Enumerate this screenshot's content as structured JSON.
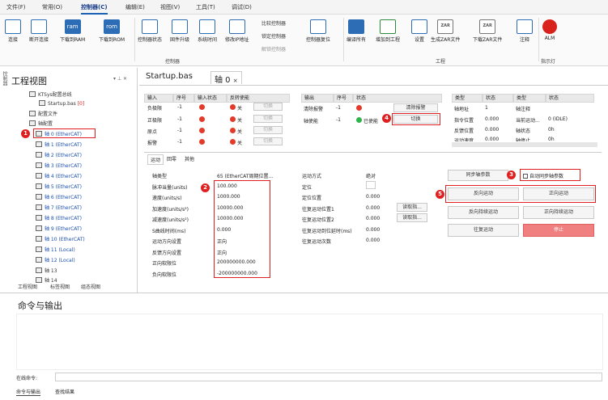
{
  "menu": {
    "items": [
      "文件(F)",
      "常用(O)",
      "控制器(C)",
      "编辑(E)",
      "视图(V)",
      "工具(T)",
      "调试(D)"
    ]
  },
  "ribbon": {
    "b": [
      "连接",
      "断开连接",
      "下载到RAM",
      "下载到ROM",
      "控制器状态",
      "固件升级",
      "系统时间",
      "修改IP地址",
      "控制器复位",
      "编译所有",
      "增加到工程",
      "设置",
      "生成ZAR文件",
      "下载ZAR文件",
      "注释",
      "ALM"
    ],
    "ram": "ram",
    "rom": "rom",
    "zar": "ZAR",
    "small": [
      "比较控制器",
      "锁定控制器",
      "解锁控制器"
    ],
    "groups": [
      "控制器",
      "工程",
      "指示灯"
    ]
  },
  "left": {
    "side": "控制器",
    "title": "工程视图",
    "pin": "▾ ⊥ ✕",
    "items": [
      "KTSys配置总线",
      "Startup.bas",
      "[0]",
      "配置文件",
      "轴配置",
      "轴 0 (EtherCAT)",
      "轴 1 (EtherCAT)",
      "轴 2 (EtherCAT)",
      "轴 3 (EtherCAT)",
      "轴 4 (EtherCAT)",
      "轴 5 (EtherCAT)",
      "轴 6 (EtherCAT)",
      "轴 7 (EtherCAT)",
      "轴 8 (EtherCAT)",
      "轴 9 (EtherCAT)",
      "轴 10 (EtherCAT)",
      "轴 11 (Local)",
      "轴 12 (Local)",
      "轴 13",
      "轴 14"
    ],
    "tabs": [
      "工程视图",
      "标签视图",
      "组态视图"
    ]
  },
  "tabs": {
    "t1": "Startup.bas",
    "t2": "轴 0",
    "close": "×"
  },
  "inputs": {
    "h": [
      "输入",
      "序号",
      "输入状态",
      "反转使能"
    ],
    "rows": [
      [
        "负极限",
        "-1",
        "关",
        "切换"
      ],
      [
        "正极限",
        "-1",
        "关",
        "切换"
      ],
      [
        "原点",
        "-1",
        "关",
        "切换"
      ],
      [
        "报警",
        "-1",
        "关",
        "切换"
      ]
    ]
  },
  "outputs": {
    "h": [
      "输出",
      "序号",
      "状态"
    ],
    "rows": [
      [
        "清除报警",
        "-1",
        "",
        "清除报警"
      ],
      [
        "轴使能",
        "-1",
        "已使能",
        "切换"
      ]
    ]
  },
  "info": {
    "h": [
      "类型",
      "状态",
      "类型",
      "状态"
    ],
    "rows": [
      [
        "轴地址",
        "1",
        "轴注释",
        ""
      ],
      [
        "指令位置",
        "0.000",
        "当前运动...",
        "0 (IDLE)"
      ],
      [
        "反馈位置",
        "0.000",
        "轴状态",
        "0h"
      ],
      [
        "运动速度",
        "0.000",
        "轴停止...",
        "0h"
      ]
    ]
  },
  "subtabs": [
    "运动",
    "回零",
    "其他"
  ],
  "params": {
    "labels": [
      "轴类型",
      "脉冲当量(units)",
      "速度(units/s)",
      "加速度(units/s²)",
      "减速度(units/s²)",
      "S曲线时间(ms)",
      "运动方向设置",
      "反馈方向设置",
      "正向软限位",
      "负向软限位"
    ],
    "values": [
      "65 (EtherCAT周期位置...",
      "100.000",
      "1000.000",
      "10000.000",
      "10000.000",
      "0.000",
      "正向",
      "正向",
      "200000000.000",
      "-200000000.000"
    ]
  },
  "move": {
    "labels": [
      "运动方式",
      "定位",
      "定位位置",
      "往复运动位置1",
      "往复运动位置2",
      "往复运动到位延时(ms)",
      "往复运动次数"
    ],
    "values": [
      "绝对",
      "",
      "0.000",
      "0.000",
      "0.000",
      "0.000",
      "0.000"
    ],
    "fetch": "读取指..."
  },
  "sync": {
    "btn": "同步轴参数",
    "chk": "自动同步轴参数"
  },
  "ctrl": {
    "b": [
      "反向运动",
      "正向运动",
      "反向持续运动",
      "正向持续运动",
      "往复运动",
      "停止"
    ]
  },
  "badges": [
    "1",
    "2",
    "3",
    "4",
    "5"
  ],
  "cmd": {
    "title": "命令与输出",
    "label": "在线命令:",
    "tabs": [
      "命令与输出",
      "查找结果"
    ]
  }
}
